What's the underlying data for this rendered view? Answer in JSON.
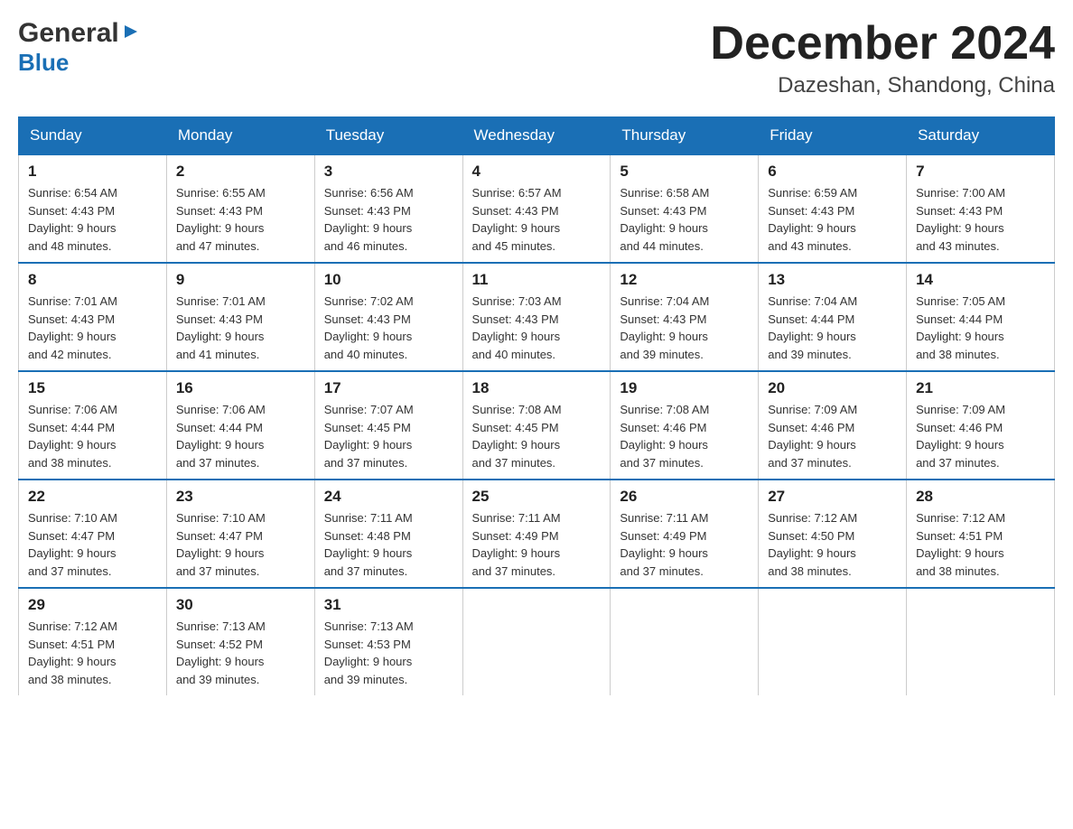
{
  "header": {
    "logo": {
      "general": "General",
      "blue": "Blue"
    },
    "title": "December 2024",
    "location": "Dazeshan, Shandong, China"
  },
  "weekdays": [
    "Sunday",
    "Monday",
    "Tuesday",
    "Wednesday",
    "Thursday",
    "Friday",
    "Saturday"
  ],
  "weeks": [
    [
      {
        "day": "1",
        "sunrise": "6:54 AM",
        "sunset": "4:43 PM",
        "daylight": "9 hours and 48 minutes."
      },
      {
        "day": "2",
        "sunrise": "6:55 AM",
        "sunset": "4:43 PM",
        "daylight": "9 hours and 47 minutes."
      },
      {
        "day": "3",
        "sunrise": "6:56 AM",
        "sunset": "4:43 PM",
        "daylight": "9 hours and 46 minutes."
      },
      {
        "day": "4",
        "sunrise": "6:57 AM",
        "sunset": "4:43 PM",
        "daylight": "9 hours and 45 minutes."
      },
      {
        "day": "5",
        "sunrise": "6:58 AM",
        "sunset": "4:43 PM",
        "daylight": "9 hours and 44 minutes."
      },
      {
        "day": "6",
        "sunrise": "6:59 AM",
        "sunset": "4:43 PM",
        "daylight": "9 hours and 43 minutes."
      },
      {
        "day": "7",
        "sunrise": "7:00 AM",
        "sunset": "4:43 PM",
        "daylight": "9 hours and 43 minutes."
      }
    ],
    [
      {
        "day": "8",
        "sunrise": "7:01 AM",
        "sunset": "4:43 PM",
        "daylight": "9 hours and 42 minutes."
      },
      {
        "day": "9",
        "sunrise": "7:01 AM",
        "sunset": "4:43 PM",
        "daylight": "9 hours and 41 minutes."
      },
      {
        "day": "10",
        "sunrise": "7:02 AM",
        "sunset": "4:43 PM",
        "daylight": "9 hours and 40 minutes."
      },
      {
        "day": "11",
        "sunrise": "7:03 AM",
        "sunset": "4:43 PM",
        "daylight": "9 hours and 40 minutes."
      },
      {
        "day": "12",
        "sunrise": "7:04 AM",
        "sunset": "4:43 PM",
        "daylight": "9 hours and 39 minutes."
      },
      {
        "day": "13",
        "sunrise": "7:04 AM",
        "sunset": "4:44 PM",
        "daylight": "9 hours and 39 minutes."
      },
      {
        "day": "14",
        "sunrise": "7:05 AM",
        "sunset": "4:44 PM",
        "daylight": "9 hours and 38 minutes."
      }
    ],
    [
      {
        "day": "15",
        "sunrise": "7:06 AM",
        "sunset": "4:44 PM",
        "daylight": "9 hours and 38 minutes."
      },
      {
        "day": "16",
        "sunrise": "7:06 AM",
        "sunset": "4:44 PM",
        "daylight": "9 hours and 37 minutes."
      },
      {
        "day": "17",
        "sunrise": "7:07 AM",
        "sunset": "4:45 PM",
        "daylight": "9 hours and 37 minutes."
      },
      {
        "day": "18",
        "sunrise": "7:08 AM",
        "sunset": "4:45 PM",
        "daylight": "9 hours and 37 minutes."
      },
      {
        "day": "19",
        "sunrise": "7:08 AM",
        "sunset": "4:46 PM",
        "daylight": "9 hours and 37 minutes."
      },
      {
        "day": "20",
        "sunrise": "7:09 AM",
        "sunset": "4:46 PM",
        "daylight": "9 hours and 37 minutes."
      },
      {
        "day": "21",
        "sunrise": "7:09 AM",
        "sunset": "4:46 PM",
        "daylight": "9 hours and 37 minutes."
      }
    ],
    [
      {
        "day": "22",
        "sunrise": "7:10 AM",
        "sunset": "4:47 PM",
        "daylight": "9 hours and 37 minutes."
      },
      {
        "day": "23",
        "sunrise": "7:10 AM",
        "sunset": "4:47 PM",
        "daylight": "9 hours and 37 minutes."
      },
      {
        "day": "24",
        "sunrise": "7:11 AM",
        "sunset": "4:48 PM",
        "daylight": "9 hours and 37 minutes."
      },
      {
        "day": "25",
        "sunrise": "7:11 AM",
        "sunset": "4:49 PM",
        "daylight": "9 hours and 37 minutes."
      },
      {
        "day": "26",
        "sunrise": "7:11 AM",
        "sunset": "4:49 PM",
        "daylight": "9 hours and 37 minutes."
      },
      {
        "day": "27",
        "sunrise": "7:12 AM",
        "sunset": "4:50 PM",
        "daylight": "9 hours and 38 minutes."
      },
      {
        "day": "28",
        "sunrise": "7:12 AM",
        "sunset": "4:51 PM",
        "daylight": "9 hours and 38 minutes."
      }
    ],
    [
      {
        "day": "29",
        "sunrise": "7:12 AM",
        "sunset": "4:51 PM",
        "daylight": "9 hours and 38 minutes."
      },
      {
        "day": "30",
        "sunrise": "7:13 AM",
        "sunset": "4:52 PM",
        "daylight": "9 hours and 39 minutes."
      },
      {
        "day": "31",
        "sunrise": "7:13 AM",
        "sunset": "4:53 PM",
        "daylight": "9 hours and 39 minutes."
      },
      null,
      null,
      null,
      null
    ]
  ],
  "labels": {
    "sunrise": "Sunrise:",
    "sunset": "Sunset:",
    "daylight": "Daylight:"
  }
}
